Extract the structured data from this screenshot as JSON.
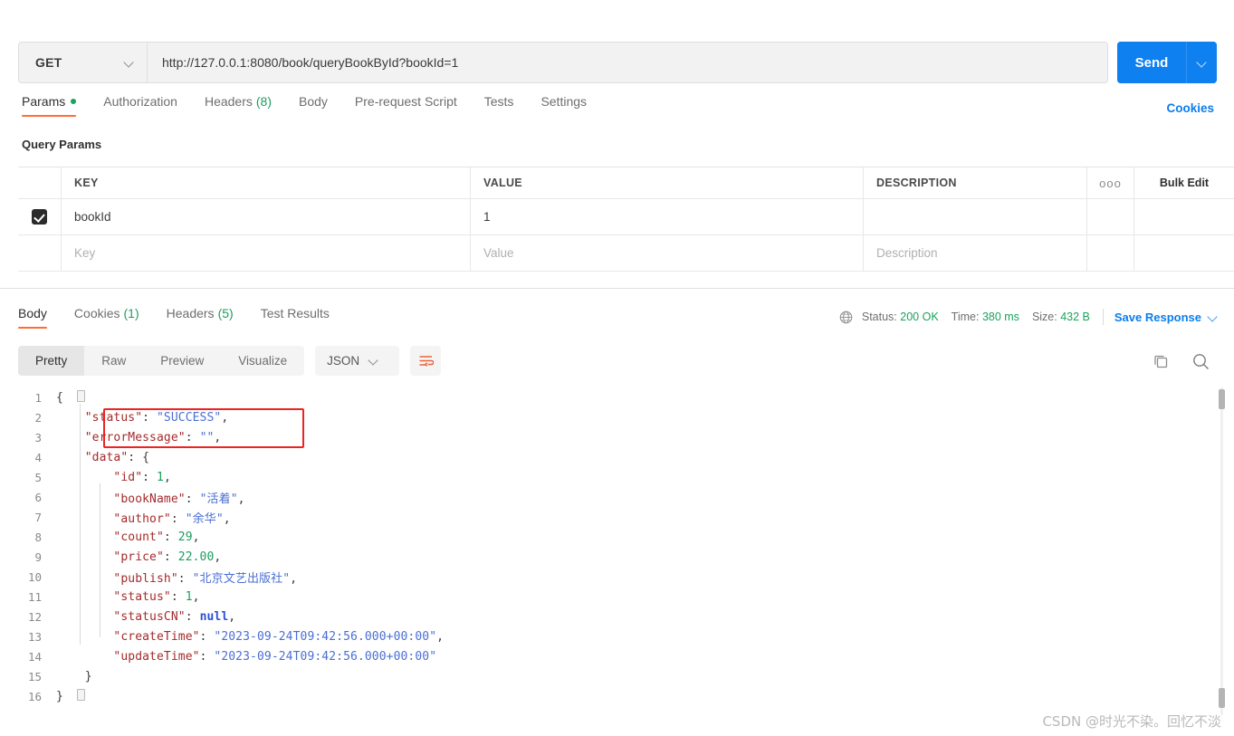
{
  "request": {
    "method": "GET",
    "url": "http://127.0.0.1:8080/book/queryBookById?bookId=1",
    "send_label": "Send",
    "tabs": [
      {
        "label": "Params",
        "badge": "",
        "dot": true,
        "active": true
      },
      {
        "label": "Authorization",
        "badge": "",
        "dot": false,
        "active": false
      },
      {
        "label": "Headers",
        "badge": "(8)",
        "dot": false,
        "active": false
      },
      {
        "label": "Body",
        "badge": "",
        "dot": false,
        "active": false
      },
      {
        "label": "Pre-request Script",
        "badge": "",
        "dot": false,
        "active": false
      },
      {
        "label": "Tests",
        "badge": "",
        "dot": false,
        "active": false
      },
      {
        "label": "Settings",
        "badge": "",
        "dot": false,
        "active": false
      }
    ],
    "cookies_link": "Cookies"
  },
  "query_params": {
    "title": "Query Params",
    "headers": {
      "key": "KEY",
      "value": "VALUE",
      "description": "DESCRIPTION",
      "dots": "ooo",
      "bulk_edit": "Bulk Edit"
    },
    "rows": [
      {
        "checked": true,
        "key": "bookId",
        "value": "1",
        "description": ""
      }
    ],
    "placeholder_row": {
      "key": "Key",
      "value": "Value",
      "description": "Description"
    }
  },
  "response": {
    "tabs": [
      {
        "label": "Body",
        "badge": "",
        "active": true
      },
      {
        "label": "Cookies",
        "badge": "(1)",
        "active": false
      },
      {
        "label": "Headers",
        "badge": "(5)",
        "active": false
      },
      {
        "label": "Test Results",
        "badge": "",
        "active": false
      }
    ],
    "status_label": "Status:",
    "status_value": "200 OK",
    "time_label": "Time:",
    "time_value": "380 ms",
    "size_label": "Size:",
    "size_value": "432 B",
    "save_response": "Save Response",
    "view_modes": [
      {
        "label": "Pretty",
        "active": true
      },
      {
        "label": "Raw",
        "active": false
      },
      {
        "label": "Preview",
        "active": false
      },
      {
        "label": "Visualize",
        "active": false
      }
    ],
    "format": "JSON",
    "body_lines": [
      {
        "n": "1",
        "segments": [
          {
            "t": "{",
            "c": "p"
          }
        ]
      },
      {
        "n": "2",
        "segments": [
          {
            "t": "    ",
            "c": "p"
          },
          {
            "t": "\"status\"",
            "c": "k"
          },
          {
            "t": ": ",
            "c": "p"
          },
          {
            "t": "\"SUCCESS\"",
            "c": "s"
          },
          {
            "t": ",",
            "c": "p"
          }
        ]
      },
      {
        "n": "3",
        "segments": [
          {
            "t": "    ",
            "c": "p"
          },
          {
            "t": "\"errorMessage\"",
            "c": "k"
          },
          {
            "t": ": ",
            "c": "p"
          },
          {
            "t": "\"\"",
            "c": "s"
          },
          {
            "t": ",",
            "c": "p"
          }
        ]
      },
      {
        "n": "4",
        "segments": [
          {
            "t": "    ",
            "c": "p"
          },
          {
            "t": "\"data\"",
            "c": "k"
          },
          {
            "t": ": {",
            "c": "p"
          }
        ]
      },
      {
        "n": "5",
        "segments": [
          {
            "t": "        ",
            "c": "p"
          },
          {
            "t": "\"id\"",
            "c": "k"
          },
          {
            "t": ": ",
            "c": "p"
          },
          {
            "t": "1",
            "c": "n"
          },
          {
            "t": ",",
            "c": "p"
          }
        ]
      },
      {
        "n": "6",
        "segments": [
          {
            "t": "        ",
            "c": "p"
          },
          {
            "t": "\"bookName\"",
            "c": "k"
          },
          {
            "t": ": ",
            "c": "p"
          },
          {
            "t": "\"活着\"",
            "c": "s"
          },
          {
            "t": ",",
            "c": "p"
          }
        ]
      },
      {
        "n": "7",
        "segments": [
          {
            "t": "        ",
            "c": "p"
          },
          {
            "t": "\"author\"",
            "c": "k"
          },
          {
            "t": ": ",
            "c": "p"
          },
          {
            "t": "\"余华\"",
            "c": "s"
          },
          {
            "t": ",",
            "c": "p"
          }
        ]
      },
      {
        "n": "8",
        "segments": [
          {
            "t": "        ",
            "c": "p"
          },
          {
            "t": "\"count\"",
            "c": "k"
          },
          {
            "t": ": ",
            "c": "p"
          },
          {
            "t": "29",
            "c": "n"
          },
          {
            "t": ",",
            "c": "p"
          }
        ]
      },
      {
        "n": "9",
        "segments": [
          {
            "t": "        ",
            "c": "p"
          },
          {
            "t": "\"price\"",
            "c": "k"
          },
          {
            "t": ": ",
            "c": "p"
          },
          {
            "t": "22.00",
            "c": "n"
          },
          {
            "t": ",",
            "c": "p"
          }
        ]
      },
      {
        "n": "10",
        "segments": [
          {
            "t": "        ",
            "c": "p"
          },
          {
            "t": "\"publish\"",
            "c": "k"
          },
          {
            "t": ": ",
            "c": "p"
          },
          {
            "t": "\"北京文艺出版社\"",
            "c": "s"
          },
          {
            "t": ",",
            "c": "p"
          }
        ]
      },
      {
        "n": "11",
        "segments": [
          {
            "t": "        ",
            "c": "p"
          },
          {
            "t": "\"status\"",
            "c": "k"
          },
          {
            "t": ": ",
            "c": "p"
          },
          {
            "t": "1",
            "c": "n"
          },
          {
            "t": ",",
            "c": "p"
          }
        ]
      },
      {
        "n": "12",
        "segments": [
          {
            "t": "        ",
            "c": "p"
          },
          {
            "t": "\"statusCN\"",
            "c": "k"
          },
          {
            "t": ": ",
            "c": "p"
          },
          {
            "t": "null",
            "c": "nul"
          },
          {
            "t": ",",
            "c": "p"
          }
        ]
      },
      {
        "n": "13",
        "segments": [
          {
            "t": "        ",
            "c": "p"
          },
          {
            "t": "\"createTime\"",
            "c": "k"
          },
          {
            "t": ": ",
            "c": "p"
          },
          {
            "t": "\"2023-09-24T09:42:56.000+00:00\"",
            "c": "s"
          },
          {
            "t": ",",
            "c": "p"
          }
        ]
      },
      {
        "n": "14",
        "segments": [
          {
            "t": "        ",
            "c": "p"
          },
          {
            "t": "\"updateTime\"",
            "c": "k"
          },
          {
            "t": ": ",
            "c": "p"
          },
          {
            "t": "\"2023-09-24T09:42:56.000+00:00\"",
            "c": "s"
          }
        ]
      },
      {
        "n": "15",
        "segments": [
          {
            "t": "    }",
            "c": "p"
          }
        ]
      },
      {
        "n": "16",
        "segments": [
          {
            "t": "}",
            "c": "p"
          }
        ]
      }
    ]
  },
  "annotation": {
    "highlight_color": "#ee2222"
  },
  "watermark": "CSDN @时光不染。回忆不淡"
}
